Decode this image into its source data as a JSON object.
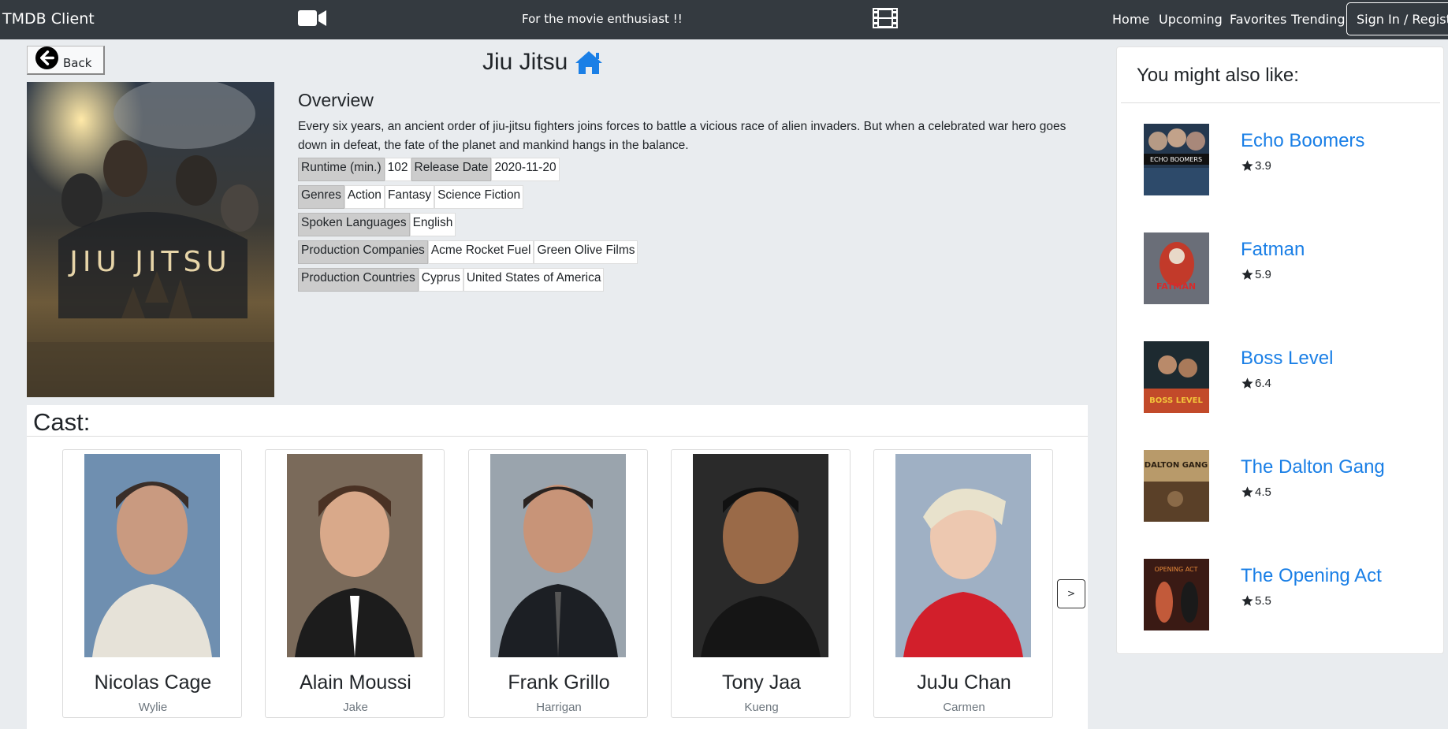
{
  "navbar": {
    "brand": "TMDB Client",
    "tagline": "For the movie enthusiast !!",
    "links": [
      "Home",
      "Upcoming",
      "Favorites",
      "Trending"
    ],
    "signin": "Sign In / Register"
  },
  "back_label": "Back",
  "movie": {
    "title": "Jiu Jitsu",
    "poster_text": "JIU JITSU",
    "overview_heading": "Overview",
    "overview": "Every six years, an ancient order of jiu-jitsu fighters joins forces to battle a vicious race of alien invaders. But when a celebrated war hero goes down in defeat, the fate of the planet and mankind hangs in the balance.",
    "runtime_label": "Runtime (min.)",
    "runtime": "102",
    "release_label": "Release Date",
    "release_date": "2020-11-20",
    "genres_label": "Genres",
    "genres": [
      "Action",
      "Fantasy",
      "Science Fiction"
    ],
    "languages_label": "Spoken Languages",
    "languages": [
      "English"
    ],
    "companies_label": "Production Companies",
    "companies": [
      "Acme Rocket Fuel",
      "Green Olive Films"
    ],
    "countries_label": "Production Countries",
    "countries": [
      "Cyprus",
      "United States of America"
    ]
  },
  "cast": {
    "heading": "Cast:",
    "next": ">",
    "members": [
      {
        "name": "Nicolas Cage",
        "role": "Wylie"
      },
      {
        "name": "Alain Moussi",
        "role": "Jake"
      },
      {
        "name": "Frank Grillo",
        "role": "Harrigan"
      },
      {
        "name": "Tony Jaa",
        "role": "Kueng"
      },
      {
        "name": "JuJu Chan",
        "role": "Carmen"
      }
    ]
  },
  "recommendations": {
    "heading": "You might also like:",
    "items": [
      {
        "title": "Echo Boomers",
        "rating": "3.9",
        "thumb_text": "ECHO BOOMERS"
      },
      {
        "title": "Fatman",
        "rating": "5.9",
        "thumb_text": "FATMAN"
      },
      {
        "title": "Boss Level",
        "rating": "6.4",
        "thumb_text": "BOSS LEVEL"
      },
      {
        "title": "The Dalton Gang",
        "rating": "4.5",
        "thumb_text": "DALTON GANG"
      },
      {
        "title": "The Opening Act",
        "rating": "5.5",
        "thumb_text": "OPENING ACT"
      }
    ]
  },
  "colors": {
    "navbar": "#343a40",
    "link": "#1a7fe6",
    "home_icon": "#1a7fe6",
    "background": "#e9ecef"
  }
}
